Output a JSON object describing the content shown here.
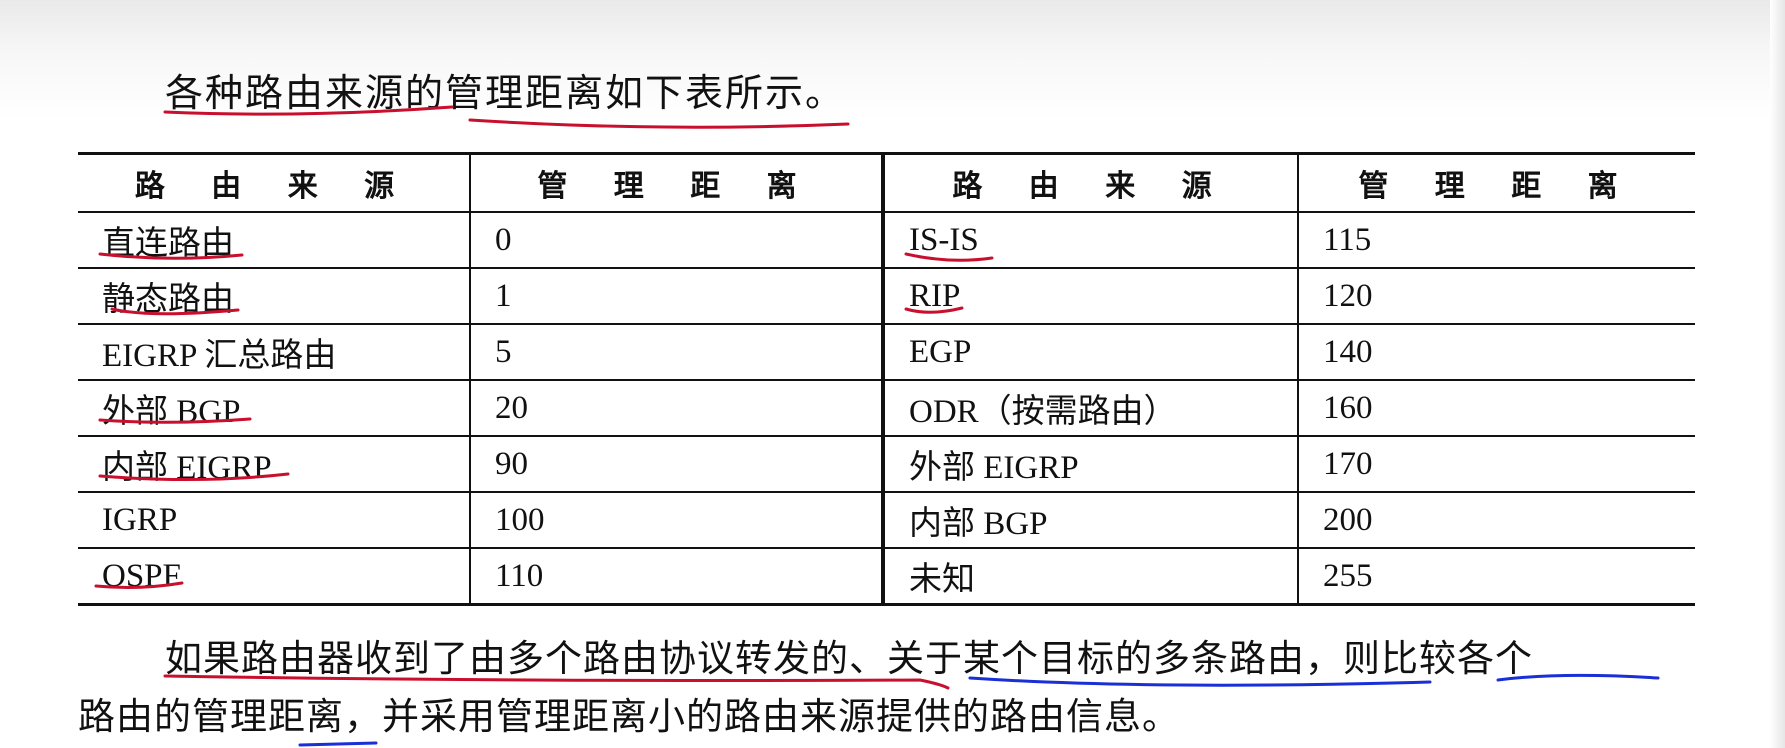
{
  "intro_text": "各种路由来源的管理距离如下表所示。",
  "table": {
    "headers": [
      "路 由 来 源",
      "管 理 距 离",
      "路 由 来 源",
      "管 理 距 离"
    ],
    "rows": [
      {
        "source_left": "直连路由",
        "distance_left": "0",
        "source_right": "IS-IS",
        "distance_right": "115"
      },
      {
        "source_left": "静态路由",
        "distance_left": "1",
        "source_right": "RIP",
        "distance_right": "120"
      },
      {
        "source_left": "EIGRP 汇总路由",
        "distance_left": "5",
        "source_right": "EGP",
        "distance_right": "140"
      },
      {
        "source_left": "外部 BGP",
        "distance_left": "20",
        "source_right": "ODR（按需路由）",
        "distance_right": "160"
      },
      {
        "source_left": "内部 EIGRP",
        "distance_left": "90",
        "source_right": "外部 EIGRP",
        "distance_right": "170"
      },
      {
        "source_left": "IGRP",
        "distance_left": "100",
        "source_right": "内部 BGP",
        "distance_right": "200"
      },
      {
        "source_left": "OSPF",
        "distance_left": "110",
        "source_right": "未知",
        "distance_right": "255"
      }
    ]
  },
  "paragraph": {
    "line1": "如果路由器收到了由多个路由协议转发的、关于某个目标的多条路由，则比较各个",
    "line2": "路由的管理距离，并采用管理距离小的路由来源提供的路由信息。"
  },
  "annotation_colors": {
    "red": "#c8102e",
    "blue": "#1a2fd6"
  }
}
